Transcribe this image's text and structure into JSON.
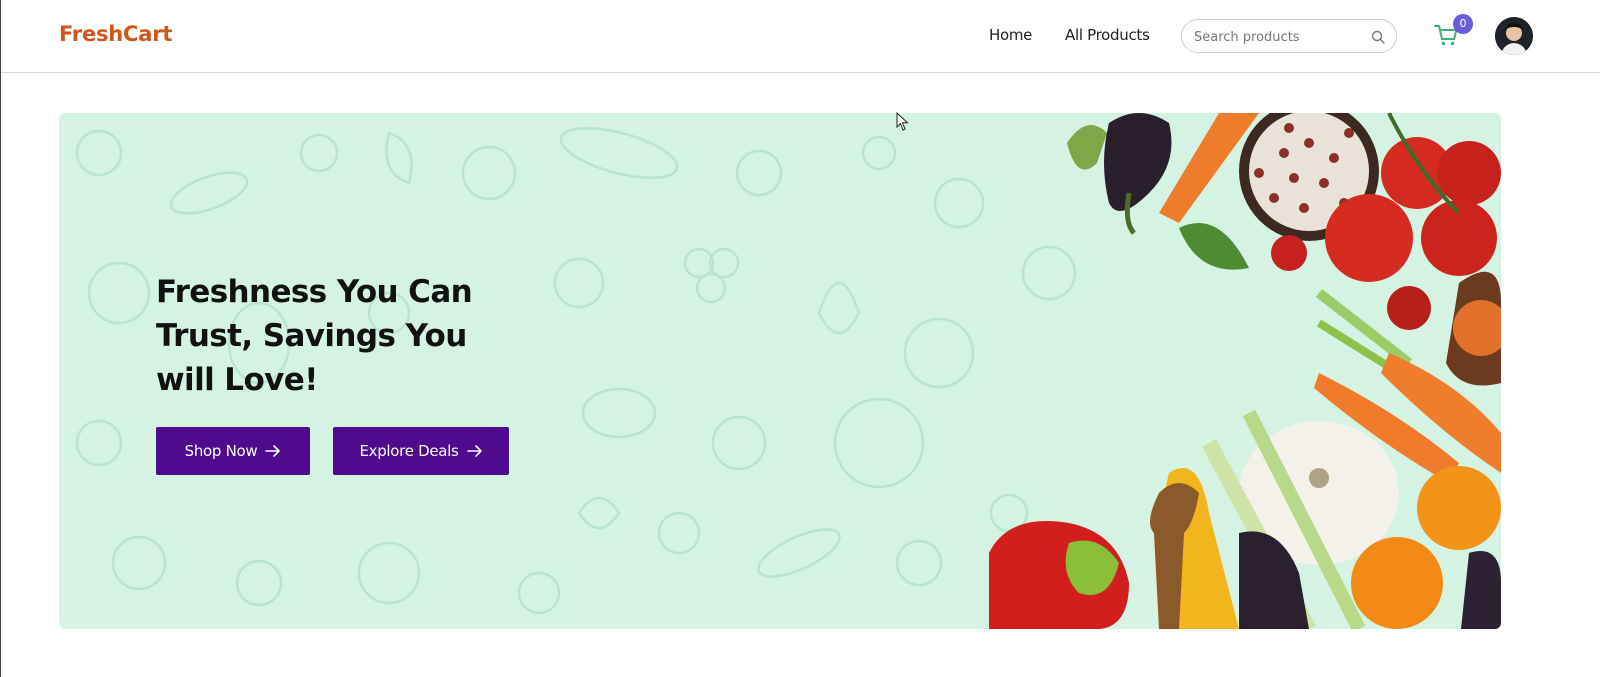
{
  "header": {
    "logo": "FreshCart",
    "nav": [
      {
        "label": "Home"
      },
      {
        "label": "All Products"
      }
    ],
    "search": {
      "placeholder": "Search products",
      "value": ""
    },
    "cart_count": "0"
  },
  "hero": {
    "title": "Freshness You Can Trust, Savings You will Love!",
    "buttons": [
      {
        "label": "Shop Now"
      },
      {
        "label": "Explore Deals"
      }
    ]
  },
  "colors": {
    "brand": "#d1561c",
    "accent": "#4f0a8e",
    "hero_bg": "#d4f3e3",
    "badge": "#6a5bd6"
  },
  "icons": [
    "search-icon",
    "cart-icon",
    "avatar",
    "arrow-right-icon",
    "mouse-cursor-icon"
  ]
}
